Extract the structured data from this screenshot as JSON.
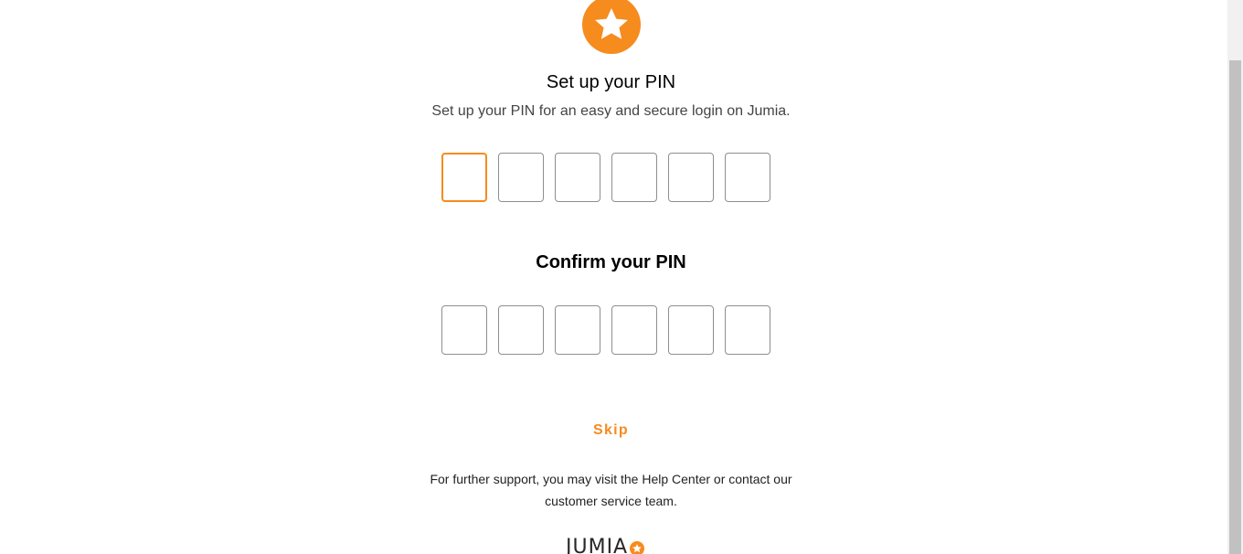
{
  "setup": {
    "title": "Set up your PIN",
    "subtitle": "Set up your PIN for an easy and secure login on Jumia."
  },
  "confirm": {
    "title": "Confirm your PIN"
  },
  "skip_label": "Skip",
  "support": {
    "line1": "For further support, you may visit the Help Center or contact our",
    "line2": "customer service team."
  },
  "brand": {
    "name": "JUMIA"
  },
  "icons": {
    "header": "star-icon",
    "brand": "star-icon"
  },
  "colors": {
    "accent": "#f68b1e"
  }
}
